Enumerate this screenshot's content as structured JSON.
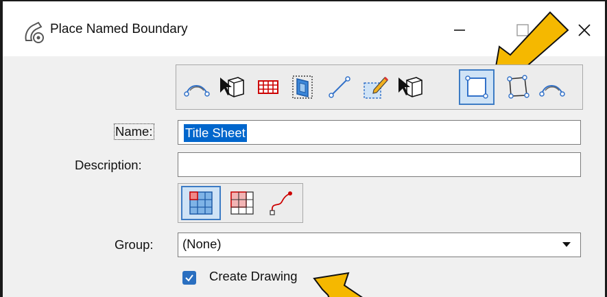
{
  "window": {
    "title": "Place Named Boundary",
    "controls": {
      "minimize": "minimize-icon",
      "maximize": "maximize-icon",
      "close": "close-icon"
    }
  },
  "toolbar": {
    "tools": [
      {
        "icon": "civil-stationing-icon"
      },
      {
        "icon": "from-view-icon"
      },
      {
        "icon": "grid-icon"
      },
      {
        "icon": "from-volume-icon"
      },
      {
        "icon": "line-icon"
      },
      {
        "icon": "edit-element-icon"
      },
      {
        "icon": "pick-element-icon"
      },
      {
        "icon": "rectangle-icon",
        "selected": true
      },
      {
        "icon": "shape-icon"
      },
      {
        "icon": "profile-icon"
      }
    ]
  },
  "form": {
    "name_label": "Name:",
    "name_value": "Title Sheet",
    "description_label": "Description:",
    "description_value": "",
    "group_label": "Group:",
    "group_value": "(None)",
    "create_drawing_label": "Create Drawing",
    "create_drawing_checked": true
  },
  "mode_options": [
    {
      "icon": "grid-mode-icon",
      "selected": true
    },
    {
      "icon": "grid-red-icon"
    },
    {
      "icon": "curve-icon"
    }
  ],
  "colors": {
    "accent": "#2a6fc0",
    "selection": "#0066cc",
    "annotation_arrow": "#f5b800"
  }
}
